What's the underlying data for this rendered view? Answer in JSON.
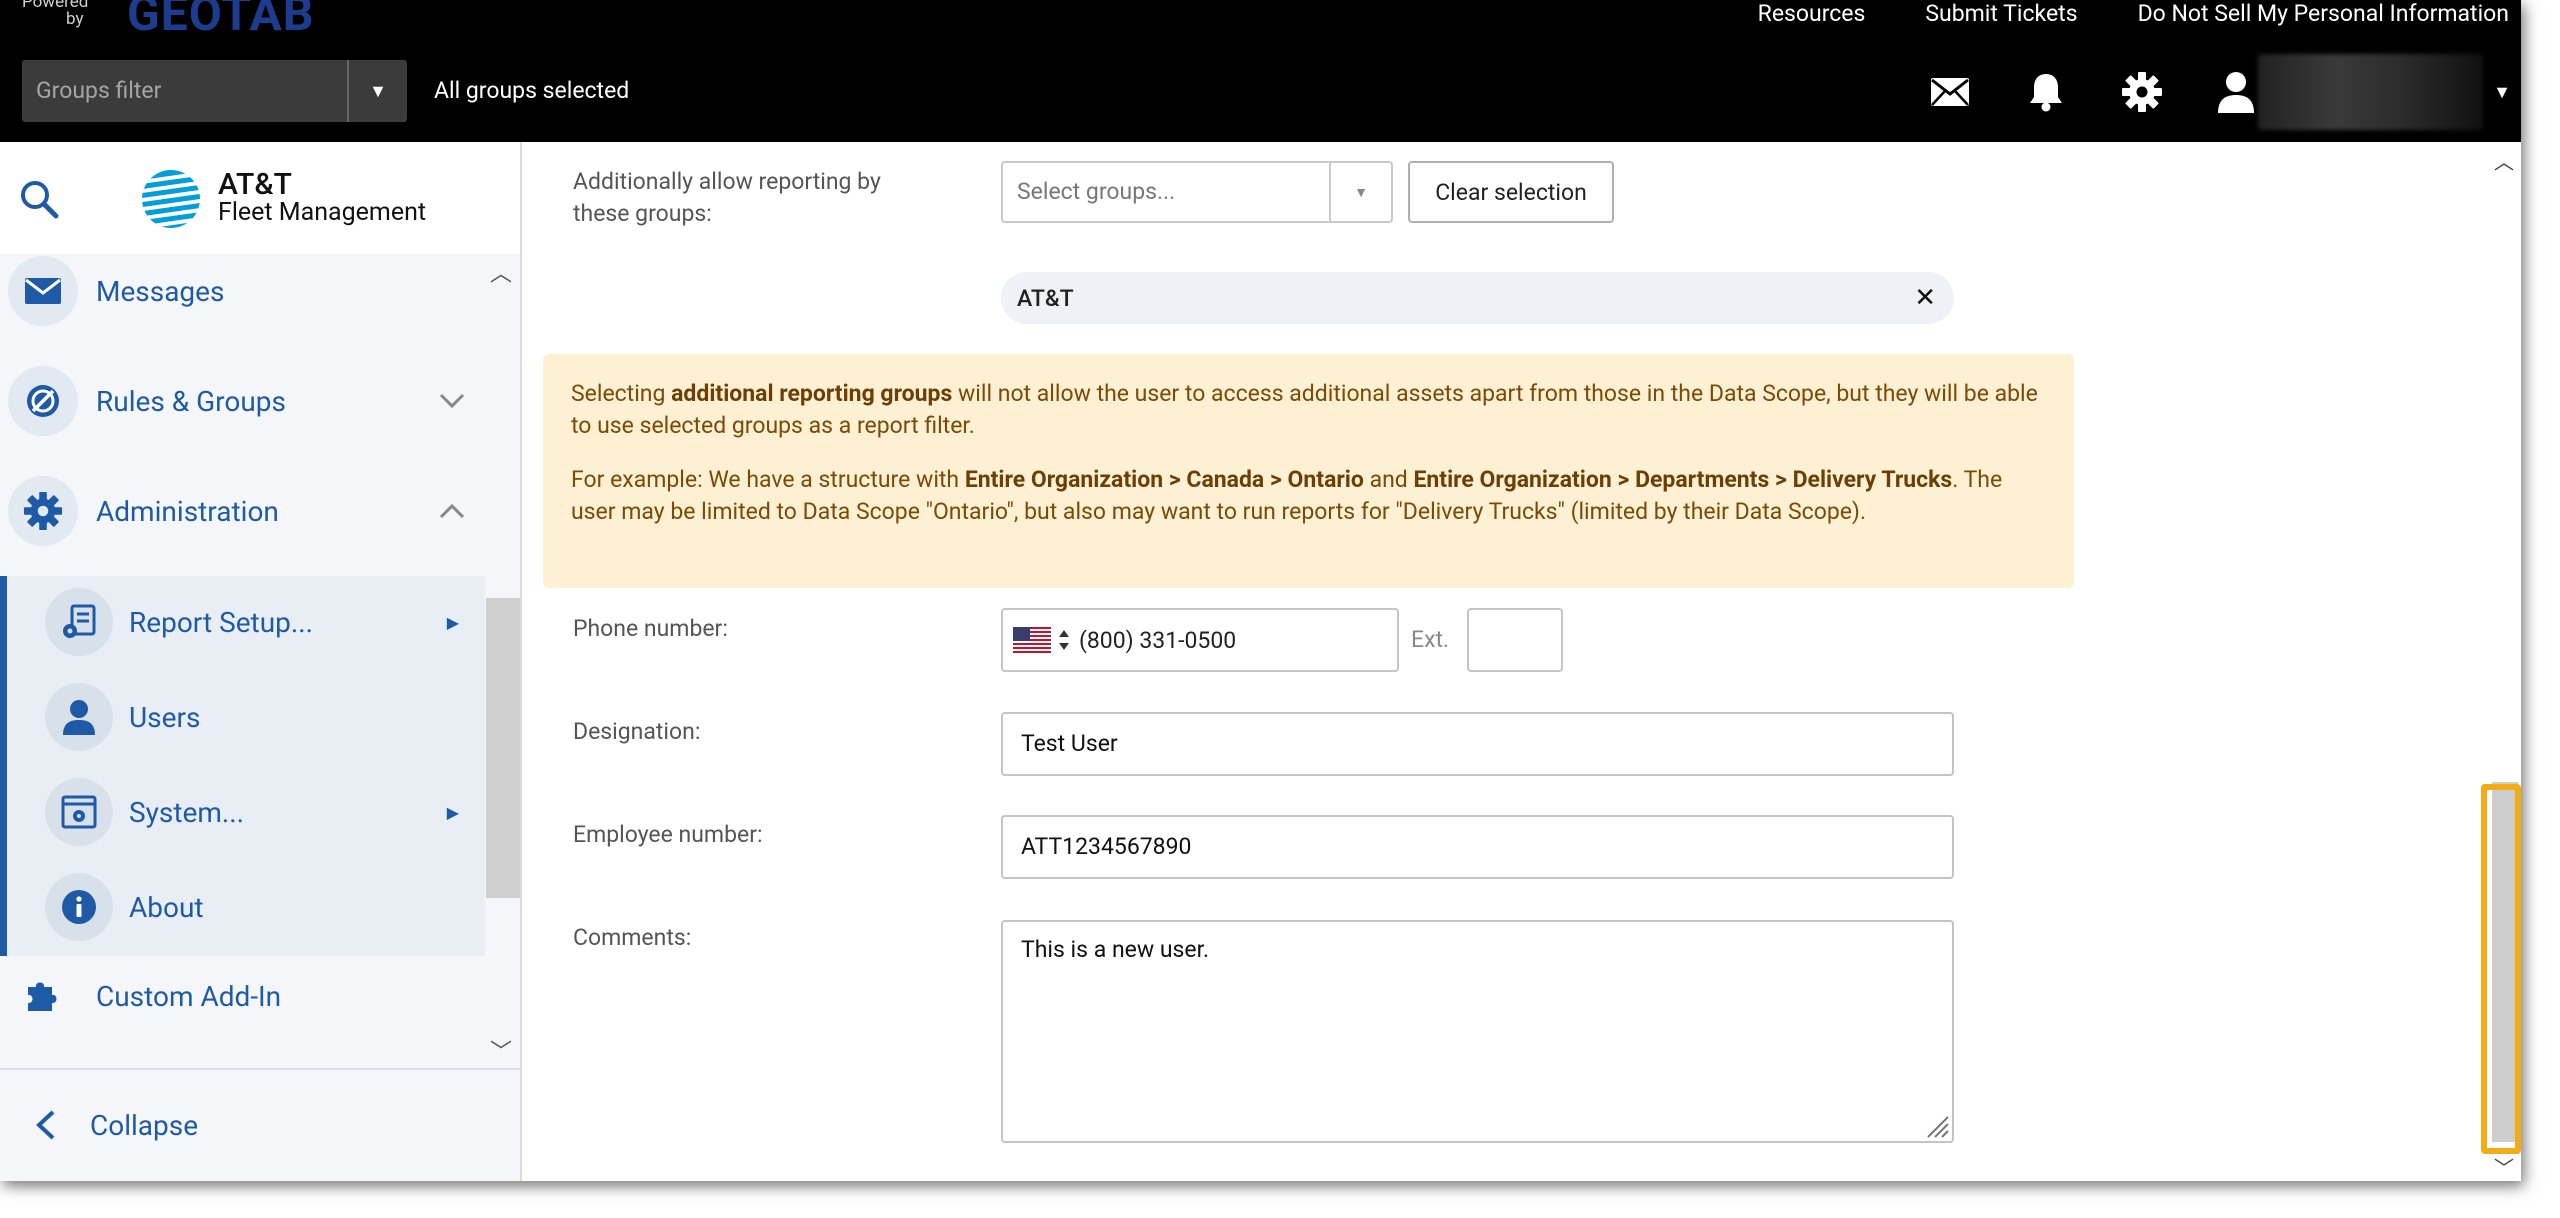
{
  "topbar": {
    "powered_line1": "Powered",
    "powered_line2": "by",
    "logo": "GEOTAB",
    "links": [
      "Resources",
      "Submit Tickets",
      "Do Not Sell My Personal Information"
    ],
    "groups_filter_placeholder": "Groups filter",
    "groups_status": "All groups selected",
    "icons": [
      "mail-icon",
      "bell-icon",
      "gear-icon",
      "user-icon"
    ]
  },
  "sidebar": {
    "brand_line1": "AT&T",
    "brand_line2": "Fleet Management",
    "items": [
      {
        "label": "Messages",
        "icon": "envelope-icon"
      },
      {
        "label": "Rules & Groups",
        "icon": "rules-icon"
      },
      {
        "label": "Administration",
        "icon": "gear-icon"
      }
    ],
    "submenu": [
      {
        "label": "Report Setup...",
        "icon": "report-setup-icon"
      },
      {
        "label": "Users",
        "icon": "user-icon"
      },
      {
        "label": "System...",
        "icon": "system-icon"
      },
      {
        "label": "About",
        "icon": "info-icon"
      }
    ],
    "addin": {
      "label": "Custom Add-In",
      "icon": "puzzle-icon"
    },
    "collapse_label": "Collapse"
  },
  "form": {
    "reporting_label": "Additionally allow reporting by these groups:",
    "select_groups_placeholder": "Select groups...",
    "clear_selection": "Clear selection",
    "chip": "AT&T",
    "notice_p1_pre": "Selecting ",
    "notice_p1_bold": "additional reporting groups",
    "notice_p1_post": " will not allow the user to access additional assets apart from those in the Data Scope, but they will be able to use selected groups as a report filter.",
    "notice_p2_pre": "For example: We have a structure with ",
    "notice_p2_bold1": "Entire Organization > Canada > Ontario",
    "notice_p2_mid": " and ",
    "notice_p2_bold2": "Entire Organization > Departments > Delivery Trucks",
    "notice_p2_post": ". The user may be limited to Data Scope \"Ontario\", but also may want to run reports for \"Delivery Trucks\" (limited by their Data Scope).",
    "phone_label": "Phone number:",
    "phone_value": "(800) 331-0500",
    "ext_label": "Ext.",
    "ext_value": "",
    "designation_label": "Designation:",
    "designation_value": "Test User",
    "employee_label": "Employee number:",
    "employee_value": "ATT1234567890",
    "comments_label": "Comments:",
    "comments_value": "This is a new user."
  },
  "colors": {
    "brand_blue": "#1f5aa6",
    "notice_bg": "#fdf0d3",
    "highlight": "#f4ac16"
  }
}
